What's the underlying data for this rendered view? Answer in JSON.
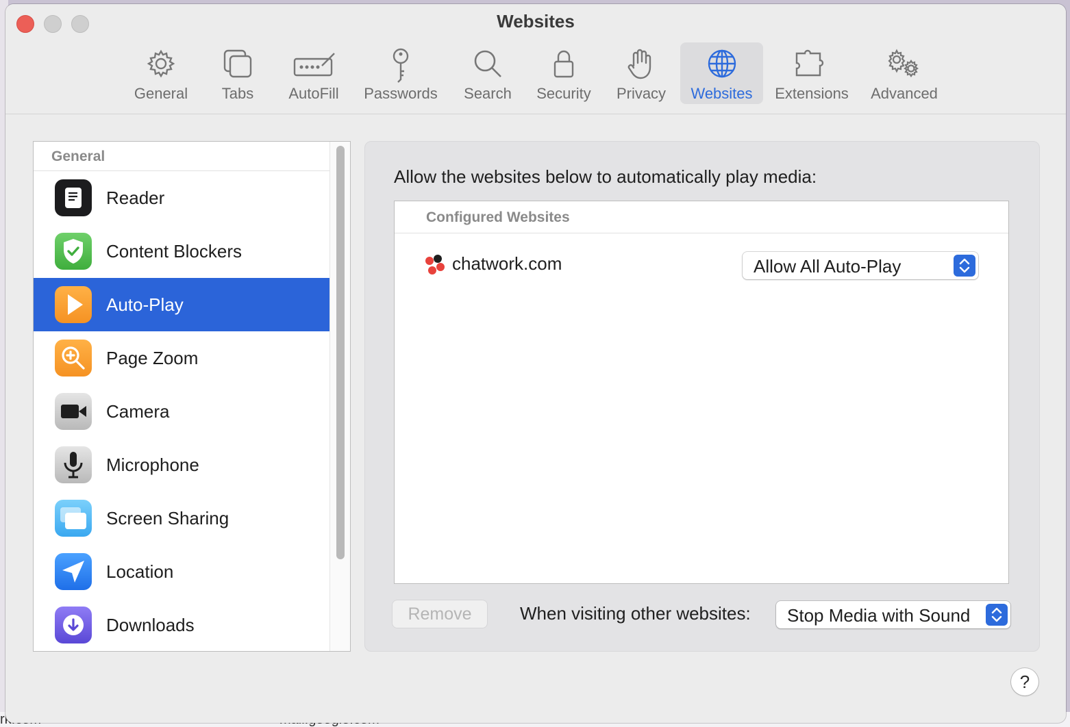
{
  "window": {
    "title": "Websites"
  },
  "toolbar": {
    "tabs": [
      {
        "label": "General",
        "icon": "gear-icon"
      },
      {
        "label": "Tabs",
        "icon": "tabs-icon"
      },
      {
        "label": "AutoFill",
        "icon": "autofill-icon"
      },
      {
        "label": "Passwords",
        "icon": "key-icon"
      },
      {
        "label": "Search",
        "icon": "magnifier-icon"
      },
      {
        "label": "Security",
        "icon": "lock-icon"
      },
      {
        "label": "Privacy",
        "icon": "hand-icon"
      },
      {
        "label": "Websites",
        "icon": "globe-icon",
        "active": true
      },
      {
        "label": "Extensions",
        "icon": "puzzle-icon"
      },
      {
        "label": "Advanced",
        "icon": "gears-icon"
      }
    ]
  },
  "sidebar": {
    "section_header": "General",
    "items": [
      {
        "label": "Reader",
        "icon": "reader-icon"
      },
      {
        "label": "Content Blockers",
        "icon": "shield-check-icon"
      },
      {
        "label": "Auto-Play",
        "icon": "play-icon",
        "selected": true
      },
      {
        "label": "Page Zoom",
        "icon": "zoom-icon"
      },
      {
        "label": "Camera",
        "icon": "camera-icon"
      },
      {
        "label": "Microphone",
        "icon": "microphone-icon"
      },
      {
        "label": "Screen Sharing",
        "icon": "screen-sharing-icon"
      },
      {
        "label": "Location",
        "icon": "location-arrow-icon"
      },
      {
        "label": "Downloads",
        "icon": "download-icon"
      }
    ]
  },
  "panel": {
    "description": "Allow the websites below to automatically play media:",
    "configured_header": "Configured Websites",
    "sites": [
      {
        "name": "chatwork.com",
        "setting": "Allow All Auto-Play"
      }
    ],
    "remove_label": "Remove",
    "other_label": "When visiting other websites:",
    "other_value": "Stop Media with Sound"
  },
  "help": {
    "label": "?"
  },
  "background": {
    "left_text": "rk.com",
    "right_text": "mail.google.com"
  },
  "colors": {
    "accent": "#2d6bdc",
    "selection": "#2b64d9",
    "close": "#ec5f57"
  }
}
